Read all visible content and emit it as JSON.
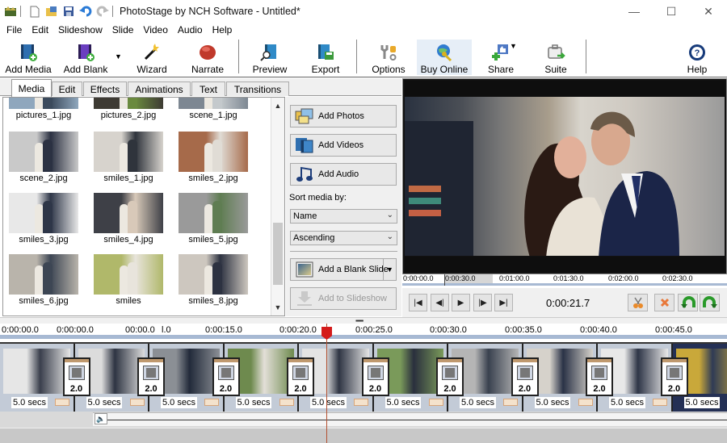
{
  "window": {
    "title": "PhotoStage by NCH Software - Untitled*",
    "controls": {
      "minimize": "—",
      "maximize": "☐",
      "close": "✕"
    }
  },
  "quick_access": [
    "app-icon",
    "new-icon",
    "open-icon",
    "save-icon",
    "undo-icon",
    "redo-icon"
  ],
  "menu": [
    "File",
    "Edit",
    "Slideshow",
    "Slide",
    "Video",
    "Audio",
    "Help"
  ],
  "toolbar": {
    "add_media": "Add Media",
    "add_blank": "Add Blank",
    "wizard": "Wizard",
    "narrate": "Narrate",
    "preview": "Preview",
    "export": "Export",
    "options": "Options",
    "buy_online": "Buy Online",
    "share": "Share",
    "suite": "Suite",
    "help": "Help"
  },
  "tabs": [
    "Media",
    "Edit",
    "Effects",
    "Animations",
    "Text",
    "Transitions"
  ],
  "active_tab": "Media",
  "media": [
    {
      "name": "pictures_1.jpg",
      "c1": "#8fa7bd",
      "c2": "#3b4a5c"
    },
    {
      "name": "pictures_2.jpg",
      "c1": "#3d3a33",
      "c2": "#6a8a3e"
    },
    {
      "name": "scene_1.jpg",
      "c1": "#7d8792",
      "c2": "#c4c9cc"
    },
    {
      "name": "scene_2.jpg",
      "c1": "#c9c9c9",
      "c2": "#2b3142"
    },
    {
      "name": "smiles_1.jpg",
      "c1": "#d7d3cd",
      "c2": "#2f343c"
    },
    {
      "name": "smiles_2.jpg",
      "c1": "#a66a4a",
      "c2": "#e0dcd5"
    },
    {
      "name": "smiles_3.jpg",
      "c1": "#e8e8e8",
      "c2": "#2e3648"
    },
    {
      "name": "smiles_4.jpg",
      "c1": "#3e4047",
      "c2": "#d8c9b9"
    },
    {
      "name": "smiles_5.jpg",
      "c1": "#9a9a9a",
      "c2": "#5f7d52"
    },
    {
      "name": "smiles_6.jpg",
      "c1": "#b9b4ab",
      "c2": "#3d4654"
    },
    {
      "name": "smiles",
      "c1": "#b0b86a",
      "c2": "#e8e4dc"
    },
    {
      "name": "smiles_8.jpg",
      "c1": "#cdc7bf",
      "c2": "#2d3241"
    }
  ],
  "side": {
    "add_photos": "Add Photos",
    "add_videos": "Add Videos",
    "add_audio": "Add Audio",
    "sort_label": "Sort media by:",
    "sort_by": "Name",
    "sort_order": "Ascending",
    "add_blank_slide": "Add a Blank Slide",
    "add_to_slideshow": "Add to Slideshow"
  },
  "preview": {
    "mini_ruler": [
      "0:00:00.0",
      "0:00:30.0",
      "0:01:00.0",
      "0:01:30.0",
      "0:02:00.0",
      "0:02:30.0"
    ],
    "current_time": "0:00:21.7"
  },
  "timeline": {
    "ruler": [
      "0:00:00.0",
      "0:00:00.0",
      "00:00.0",
      "l.0",
      "0:00:15.0",
      "0:00:20.0",
      "0:00:25.0",
      "0:00:30.0",
      "0:00:35.0",
      "0:00:40.0",
      "0:00:45.0"
    ],
    "playhead_time_seconds": 21.7,
    "slides": [
      {
        "duration": "5.0 secs",
        "c1": "#e6e6e6",
        "c2": "#3a3f4c"
      },
      {
        "duration": "5.0 secs",
        "c1": "#dcdcdc",
        "c2": "#2e3442"
      },
      {
        "duration": "5.0 secs",
        "c1": "#8b8f95",
        "c2": "#222a3a"
      },
      {
        "duration": "5.0 secs",
        "c1": "#6e8a4e",
        "c2": "#e3dfd8"
      },
      {
        "duration": "5.0 secs",
        "c1": "#e4e4e4",
        "c2": "#2f3544"
      },
      {
        "duration": "5.0 secs",
        "c1": "#7a9a5a",
        "c2": "#2a2f3d"
      },
      {
        "duration": "5.0 secs",
        "c1": "#b5b5b5",
        "c2": "#39414f"
      },
      {
        "duration": "5.0 secs",
        "c1": "#d6d2cb",
        "c2": "#2a3246"
      },
      {
        "duration": "5.0 secs",
        "c1": "#e8e8e8",
        "c2": "#2e3547"
      },
      {
        "duration": "5.0 secs",
        "c1": "#c9a83a",
        "c2": "#2f3b55"
      }
    ],
    "transitions": [
      "2.0",
      "2.0",
      "2.0",
      "2.0",
      "2.0",
      "2.0",
      "2.0",
      "2.0",
      "2.0"
    ]
  }
}
